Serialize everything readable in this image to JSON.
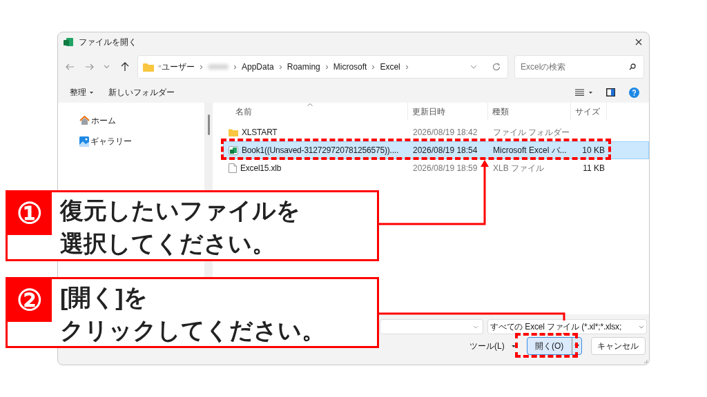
{
  "window": {
    "title": "ファイルを開く"
  },
  "address_bar": {
    "overflow": "«",
    "segments": [
      {
        "kind": "text",
        "label": "ユーザー"
      },
      {
        "kind": "redacted"
      },
      {
        "kind": "text",
        "label": "AppData"
      },
      {
        "kind": "text",
        "label": "Roaming"
      },
      {
        "kind": "text",
        "label": "Microsoft"
      },
      {
        "kind": "text",
        "label": "Excel"
      }
    ]
  },
  "search": {
    "placeholder": "Excelの検索"
  },
  "toolbar": {
    "items": [
      {
        "label": "整理",
        "dropdown": true
      },
      {
        "label": "新しいフォルダー",
        "dropdown": false
      }
    ]
  },
  "nav": {
    "items": [
      {
        "label": "ホーム",
        "kind": "home"
      },
      {
        "label": "ギャラリー",
        "kind": "gallery"
      }
    ]
  },
  "file_list": {
    "columns": [
      "名前",
      "更新日時",
      "種類",
      "サイズ"
    ],
    "rows": [
      {
        "kind": "folder",
        "name": "XLSTART",
        "modified": "2026/08/19 18:42",
        "type": "ファイル フォルダー",
        "selected": false
      },
      {
        "kind": "excel",
        "name": "Book1((Unsaved-312729720781256575))....",
        "modified": "2026/08/19 18:54",
        "type": "Microsoft Excel バ...",
        "size": "10 KB",
        "selected": true
      },
      {
        "kind": "file",
        "name": "Excel15.xlb",
        "modified": "2026/08/19 18:59",
        "type": "XLB ファイル",
        "size": "11 KB",
        "selected": false
      }
    ]
  },
  "bottom": {
    "file_type": "すべての Excel ファイル (*.xl*;*.xlsx;",
    "tools": "ツール(L)",
    "open": "開く(O)",
    "cancel": "キャンセル"
  },
  "callouts": [
    {
      "number": "①",
      "lines": [
        "復元したいファイルを",
        "選択してください。"
      ]
    },
    {
      "number": "②",
      "lines": [
        "[開く]を",
        "クリックしてください。"
      ]
    }
  ]
}
